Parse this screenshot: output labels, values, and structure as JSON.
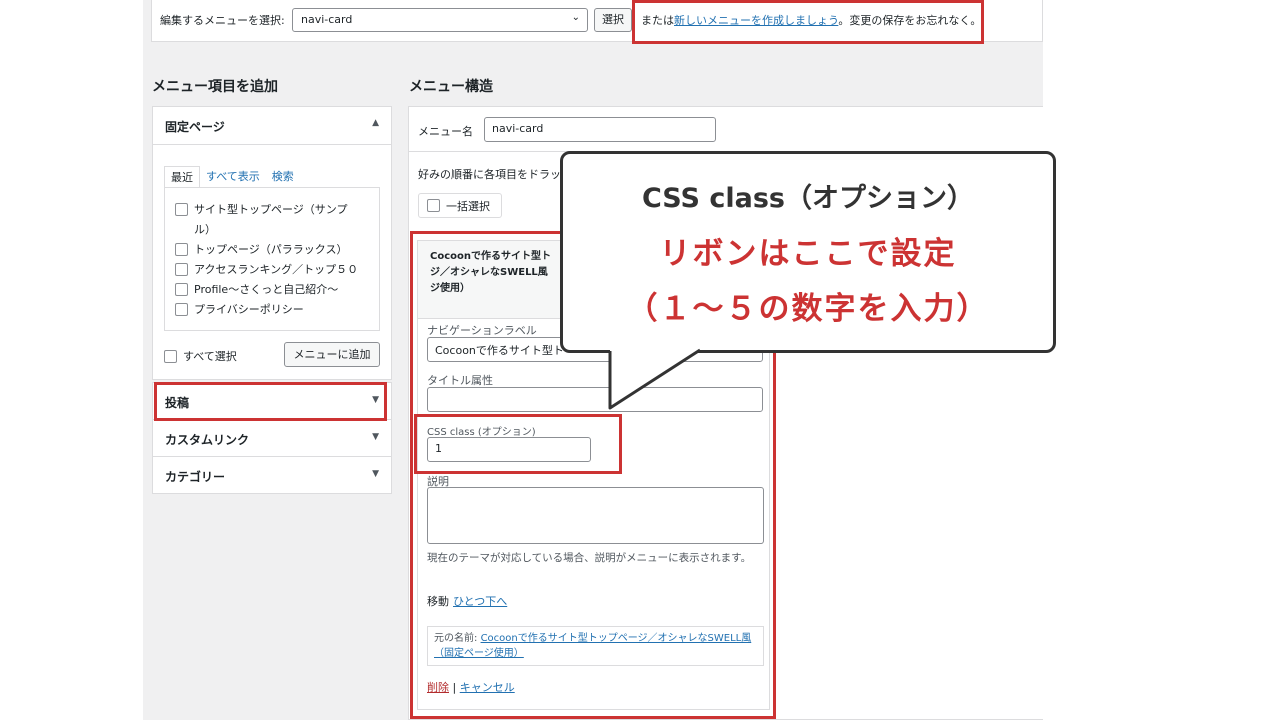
{
  "top_bar": {
    "select_label": "編集するメニューを選択:",
    "selected_menu": "navi-card",
    "select_button": "選択",
    "note_prefix": "または",
    "note_link": "新しいメニューを作成しましょう",
    "note_suffix": "。変更の保存をお忘れなく。"
  },
  "add_items": {
    "title": "メニュー項目を追加",
    "pages_panel": {
      "title": "固定ページ",
      "tabs": [
        "最近",
        "すべて表示",
        "検索"
      ],
      "items": [
        "サイト型トップページ（サンプル）",
        "トップページ（パララックス）",
        "アクセスランキング／トップ５０",
        "Profile～さくっと自己紹介～",
        "プライバシーポリシー"
      ],
      "select_all": "すべて選択",
      "add_button": "メニューに追加"
    },
    "accordions": [
      "投稿",
      "カスタムリンク",
      "カテゴリー"
    ]
  },
  "structure": {
    "title": "メニュー構造",
    "menu_name_label": "メニュー名",
    "menu_name_value": "navi-card",
    "instructions": "好みの順番に各項目をドラッ",
    "bulk_select": "一括選択",
    "item": {
      "title_line1": "Cocoonで作るサイト型ト",
      "title_line2": "ジ／オシャレなSWELL風",
      "title_line3": "ジ使用）",
      "nav_label_label": "ナビゲーションラベル",
      "nav_label_value": "Cocoonで作るサイト型ト",
      "title_attr_label": "タイトル属性",
      "title_attr_value": "",
      "css_class_label": "CSS class (オプション)",
      "css_class_value": "1",
      "description_label": "説明",
      "help_text": "現在のテーマが対応している場合、説明がメニューに表示されます。",
      "move_label": "移動",
      "move_link": "ひとつ下へ",
      "original_name_label": "元の名前:",
      "original_name_link": "Cocoonで作るサイト型トップページ／オシャレなSWELL風（固定ページ使用）",
      "delete_link": "削除",
      "separator": "|",
      "cancel_link": "キャンセル"
    }
  },
  "callout": {
    "line1": "CSS class（オプション）",
    "line2": "リボンはここで設定",
    "line3": "（１～５の数字を入力）"
  },
  "colors": {
    "highlight": "#cc3333",
    "link": "#2271b1",
    "callout_border": "#333333"
  }
}
